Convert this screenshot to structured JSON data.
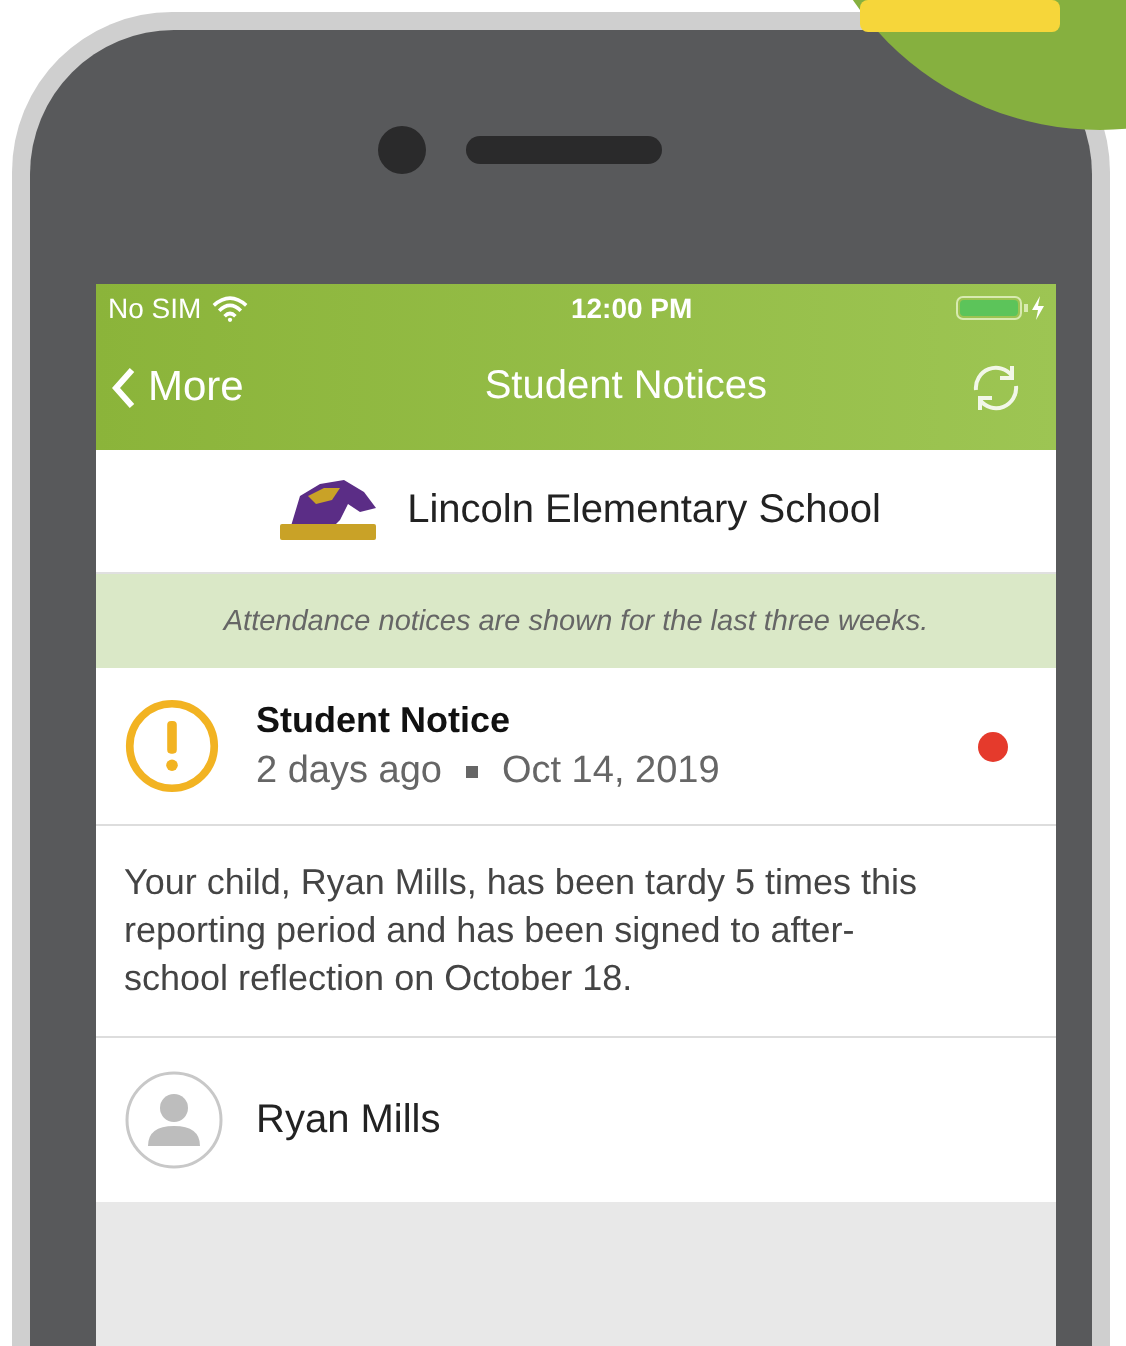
{
  "status_bar": {
    "carrier": "No SIM",
    "time": "12:00 PM"
  },
  "nav_bar": {
    "back": "More",
    "title": "Student Notices"
  },
  "school": {
    "name": "Lincoln Elementary School"
  },
  "banner": "Attendance notices are shown for the last three weeks.",
  "notice": {
    "title": "Student Notice",
    "time_ago": "2 days ago",
    "date": "Oct 14, 2019",
    "unread": true,
    "message": "Your child, Ryan Mills, has been tardy 5 times this reporting period and has been signed to after-school reflection on October 18."
  },
  "student": {
    "name": "Ryan Mills"
  }
}
